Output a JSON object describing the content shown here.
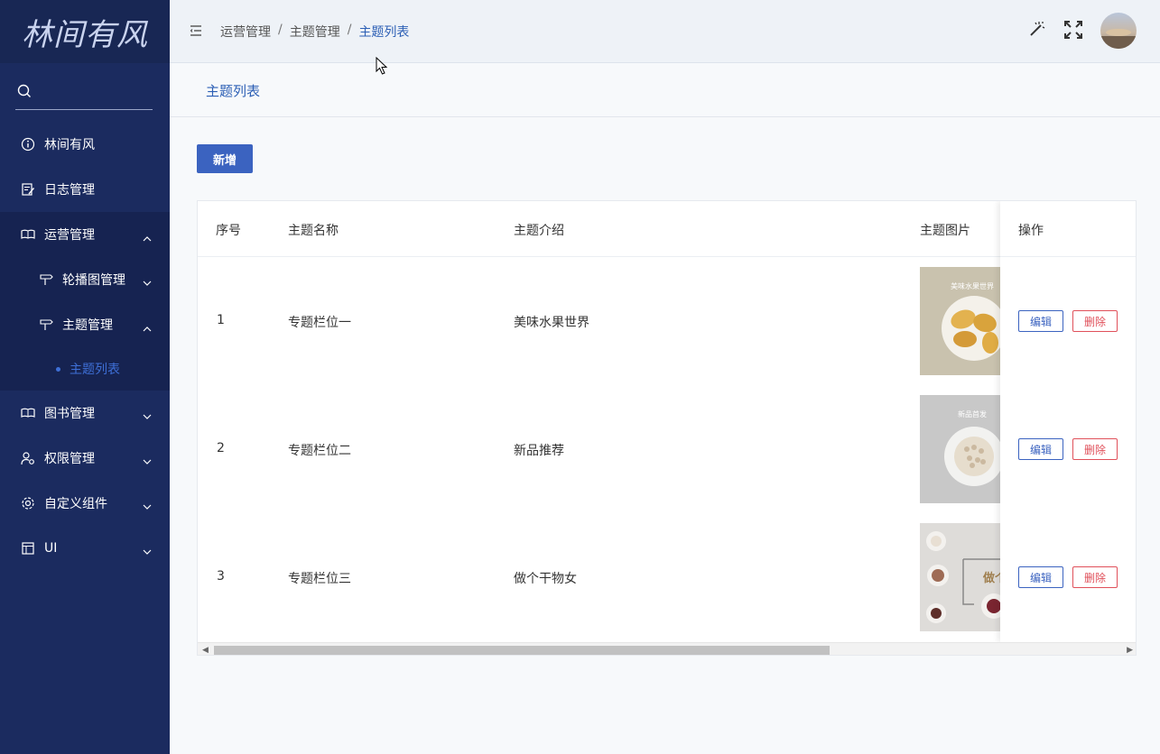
{
  "logo": {
    "text": "林间有风"
  },
  "sidebar": {
    "search_placeholder": "",
    "items": [
      {
        "label": "林间有风",
        "icon": "info-icon"
      },
      {
        "label": "日志管理",
        "icon": "edit-icon"
      },
      {
        "label": "运营管理",
        "icon": "book-icon"
      },
      {
        "label": "轮播图管理",
        "icon": "signpost-icon"
      },
      {
        "label": "主题管理",
        "icon": "signpost-icon"
      },
      {
        "label": "主题列表"
      },
      {
        "label": "图书管理",
        "icon": "book-icon"
      },
      {
        "label": "权限管理",
        "icon": "user-gear-icon"
      },
      {
        "label": "自定义组件",
        "icon": "gear-icon"
      },
      {
        "label": "UI",
        "icon": "layout-icon"
      }
    ]
  },
  "header": {
    "breadcrumb": [
      "运营管理",
      "主题管理",
      "主题列表"
    ],
    "separator": "/"
  },
  "tabs": [
    {
      "label": "主题列表"
    }
  ],
  "toolbar": {
    "add_label": "新增"
  },
  "table": {
    "columns": [
      "序号",
      "主题名称",
      "主题介绍",
      "主题图片",
      "操作"
    ],
    "rows": [
      {
        "index": "1",
        "name": "专题栏位一",
        "intro": "美味水果世界",
        "image_text": "美味水果世界"
      },
      {
        "index": "2",
        "name": "专题栏位二",
        "intro": "新品推荐",
        "image_text": "新品首发"
      },
      {
        "index": "3",
        "name": "专题栏位三",
        "intro": "做个干物女",
        "image_text": "做个"
      }
    ],
    "edit_label": "编辑",
    "delete_label": "删除"
  },
  "colors": {
    "sidebar": "#1b2b5f",
    "accent": "#3b63c0",
    "danger": "#e0505a"
  }
}
